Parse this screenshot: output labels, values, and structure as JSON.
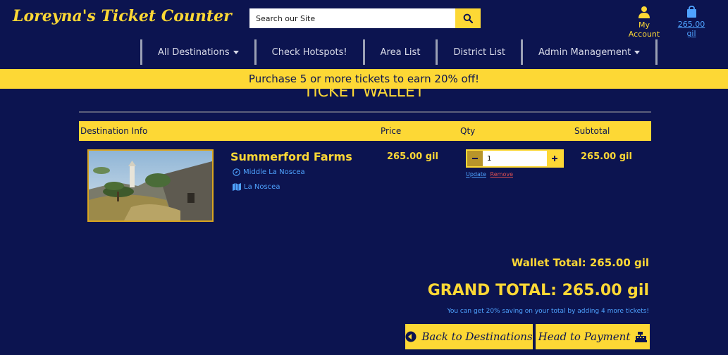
{
  "header": {
    "logo": "Loreyna's Ticket Counter",
    "search_placeholder": "Search our Site",
    "account_label": "My Account",
    "cart_total": "265.00 gil"
  },
  "nav": {
    "items": [
      {
        "label": "All Destinations",
        "dropdown": true
      },
      {
        "label": "Check Hotspots!",
        "dropdown": false
      },
      {
        "label": "Area List",
        "dropdown": false
      },
      {
        "label": "District List",
        "dropdown": false
      },
      {
        "label": "Admin Management",
        "dropdown": true
      }
    ]
  },
  "promo": "Purchase 5 or more tickets to earn 20% off!",
  "wallet": {
    "title": "TICKET WALLET",
    "headers": {
      "info": "Destination Info",
      "price": "Price",
      "qty": "Qty",
      "subtotal": "Subtotal"
    },
    "item": {
      "name": "Summerford Farms",
      "region": "Middle La Noscea",
      "area": "La Noscea",
      "price": "265.00 gil",
      "quantity": "1",
      "subtotal": "265.00 gil",
      "update_label": "Update",
      "remove_label": "Remove"
    },
    "wallet_total": "Wallet Total: 265.00 gil",
    "grand_total": "GRAND TOTAL: 265.00 gil",
    "saving_message": "You can get 20% saving on your total by adding 4 more tickets!",
    "back_button": "Back to Destinations",
    "pay_button": "Head to Payment"
  },
  "colors": {
    "background": "#0c1450",
    "accent": "#fdd835",
    "link": "#4fa3ff",
    "remove": "#e05050"
  }
}
